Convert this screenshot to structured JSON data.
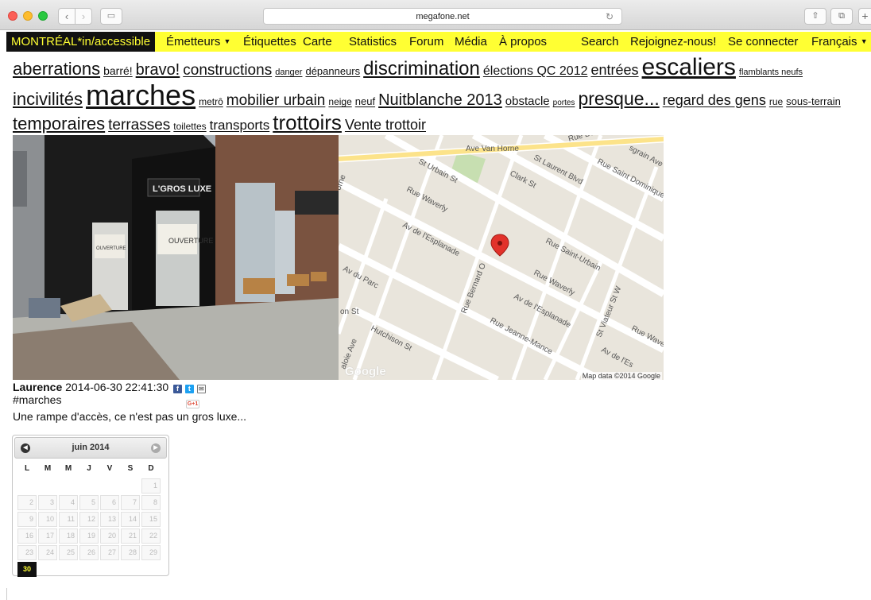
{
  "browser": {
    "url": "megafone.net",
    "back_icon": "chevron-left-icon",
    "forward_icon": "chevron-right-icon"
  },
  "nav": {
    "brand": "MONTRÉAL*in/accessible",
    "items": [
      "Émetteurs",
      "Étiquettes",
      "Carte",
      "Statistics",
      "Forum",
      "Média",
      "À propos"
    ],
    "right_items": [
      "Search",
      "Rejoignez-nous!",
      "Se connecter",
      "Français"
    ],
    "colors": {
      "bar": "#ffff33",
      "brand_bg": "#111111"
    }
  },
  "tagcloud": {
    "lines": [
      [
        {
          "label": "aberrations",
          "size": 22
        },
        {
          "label": "barré!",
          "size": 14
        },
        {
          "label": "bravo!",
          "size": 20
        },
        {
          "label": "constructions",
          "size": 19
        },
        {
          "label": "danger",
          "size": 11
        },
        {
          "label": "dépanneurs",
          "size": 13
        },
        {
          "label": "discrimination",
          "size": 24
        },
        {
          "label": "élections QC 2012",
          "size": 16
        },
        {
          "label": "entrées",
          "size": 18
        },
        {
          "label": "escaliers",
          "size": 30
        },
        {
          "label": "flamblants neufs",
          "size": 11
        }
      ],
      [
        {
          "label": "incivilités",
          "size": 22
        },
        {
          "label": "marches",
          "size": 36
        },
        {
          "label": "metrô",
          "size": 12
        },
        {
          "label": "mobilier urbain",
          "size": 19
        },
        {
          "label": "neige",
          "size": 12
        },
        {
          "label": "neuf",
          "size": 13
        },
        {
          "label": "Nuitblanche 2013",
          "size": 20
        },
        {
          "label": "obstacle",
          "size": 15
        },
        {
          "label": "portes",
          "size": 10
        },
        {
          "label": "presque...",
          "size": 23
        },
        {
          "label": "regard des gens",
          "size": 18
        },
        {
          "label": "rue",
          "size": 12
        },
        {
          "label": "sous-terrain",
          "size": 13
        }
      ],
      [
        {
          "label": "temporaires",
          "size": 22
        },
        {
          "label": "terrasses",
          "size": 19
        },
        {
          "label": "toilettes",
          "size": 12
        },
        {
          "label": "transports",
          "size": 17
        },
        {
          "label": "trottoirs",
          "size": 26
        },
        {
          "label": "Vente trottoir",
          "size": 18
        }
      ]
    ]
  },
  "photo": {
    "shop_sign": "L'GROS LUXE",
    "poster_text": "OUVERTURE"
  },
  "map": {
    "streets": [
      "Ave Van Horne",
      "Rue Bernard",
      "St Urbain St",
      "St Laurent Blvd",
      "Clark St",
      "Rue Saint Dominique",
      "Rue Waverly",
      "Av de l'Esplanade",
      "Rue Saint-Urbain",
      "Av du Parc",
      "Rue Bernard O",
      "Rue Jeanne-Mance",
      "St Viateur St W",
      "Hutchison St",
      "Rue Waverly",
      "Av de l'Esplanade",
      "Av de l'Es",
      "Rue Waver",
      "orne",
      "on St",
      "aloie Ave",
      "sgrain Ave"
    ],
    "attribution": "Map data ©2014 Google",
    "logo": "Google",
    "pin_color": "#e2322b"
  },
  "post": {
    "author": "Laurence",
    "timestamp": "2014-06-30 22:41:30",
    "tag": "#marches",
    "description": "Une rampe d'accès, ce n'est pas un gros luxe...",
    "gplus": "G+1",
    "share": {
      "facebook": "f",
      "twitter": "t",
      "mail": "✉"
    }
  },
  "calendar": {
    "month": "juin 2014",
    "weekdays": [
      "L",
      "M",
      "M",
      "J",
      "V",
      "S",
      "D"
    ],
    "days": [
      "1",
      "2",
      "3",
      "4",
      "5",
      "6",
      "7",
      "8",
      "9",
      "10",
      "11",
      "12",
      "13",
      "14",
      "15",
      "16",
      "17",
      "18",
      "19",
      "20",
      "21",
      "22",
      "23",
      "24",
      "25",
      "26",
      "27",
      "28",
      "29",
      "30"
    ],
    "active_day": "30",
    "prev_icon": "circle-arrow-left-icon",
    "next_icon": "circle-arrow-right-icon"
  }
}
